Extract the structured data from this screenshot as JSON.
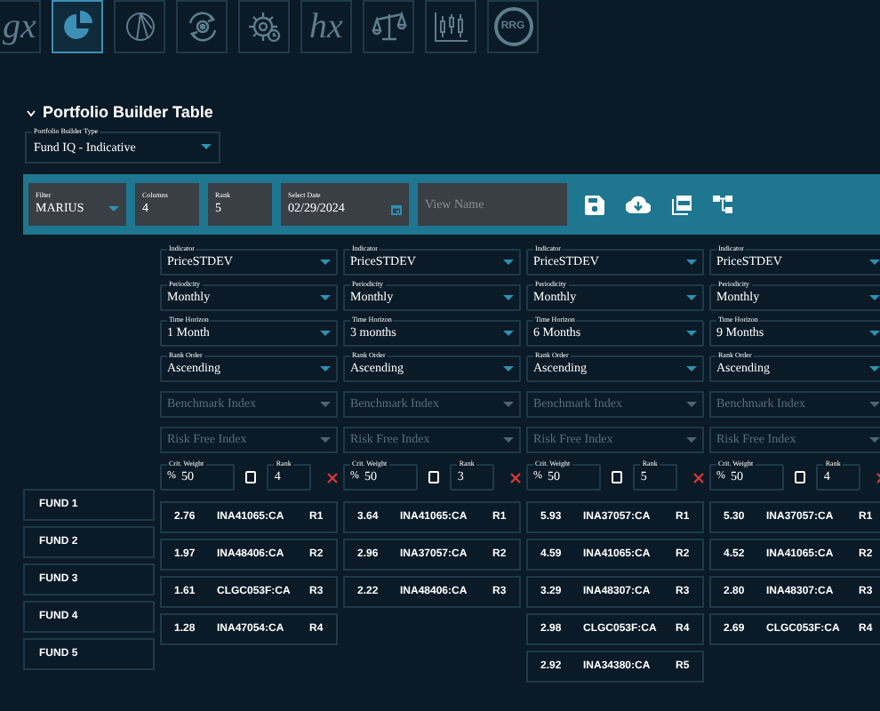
{
  "top_icons": [
    {
      "kind": "text",
      "label": "gx",
      "selected": false
    },
    {
      "kind": "pie",
      "selected": true
    },
    {
      "kind": "pie-outline",
      "selected": false
    },
    {
      "kind": "gear-cycle",
      "selected": false
    },
    {
      "kind": "gear-clock",
      "selected": false
    },
    {
      "kind": "text",
      "label": "hx",
      "selected": false
    },
    {
      "kind": "scale",
      "selected": false
    },
    {
      "kind": "candles",
      "selected": false
    },
    {
      "kind": "badge",
      "label": "RRG",
      "selected": false
    }
  ],
  "section": {
    "title": "Portfolio Builder Table",
    "expanded": true
  },
  "builder_type": {
    "label": "Portfolio Builder Type",
    "value": "Fund IQ - Indicative"
  },
  "toolbar": {
    "filter": {
      "label": "Filter",
      "value": "MARIUS"
    },
    "columns": {
      "label": "Columns",
      "value": "4"
    },
    "rank": {
      "label": "Rank",
      "value": "5"
    },
    "date": {
      "label": "Select Date",
      "value": "02/29/2024"
    },
    "view_name": {
      "placeholder": "View Name"
    }
  },
  "columns": [
    {
      "fields": [
        {
          "label": "Indicator",
          "value": "PriceSTDEV"
        },
        {
          "label": "Periodicity",
          "value": "Monthly"
        },
        {
          "label": "Time Horizon",
          "value": "1 Month"
        },
        {
          "label": "Rank Order",
          "value": "Ascending"
        }
      ],
      "benchmark": {
        "placeholder": "Benchmark Index"
      },
      "risk_free": {
        "placeholder": "Risk Free Index"
      },
      "weight": {
        "label": "Crit. Weight",
        "prefix": "%",
        "value": "50"
      },
      "checked": false,
      "rank": {
        "label": "Rank",
        "value": "4"
      },
      "results": [
        {
          "score": "2.76",
          "ticker": "INA41065:CA",
          "rank": "R1"
        },
        {
          "score": "1.97",
          "ticker": "INA48406:CA",
          "rank": "R2"
        },
        {
          "score": "1.61",
          "ticker": "CLGC053F:CA",
          "rank": "R3"
        },
        {
          "score": "1.28",
          "ticker": "INA47054:CA",
          "rank": "R4"
        }
      ]
    },
    {
      "fields": [
        {
          "label": "Indicator",
          "value": "PriceSTDEV"
        },
        {
          "label": "Periodicity",
          "value": "Monthly"
        },
        {
          "label": "Time Horizon",
          "value": "3 months"
        },
        {
          "label": "Rank Order",
          "value": "Ascending"
        }
      ],
      "benchmark": {
        "placeholder": "Benchmark Index"
      },
      "risk_free": {
        "placeholder": "Risk Free Index"
      },
      "weight": {
        "label": "Crit. Weight",
        "prefix": "%",
        "value": "50"
      },
      "checked": false,
      "rank": {
        "label": "Rank",
        "value": "3"
      },
      "results": [
        {
          "score": "3.64",
          "ticker": "INA41065:CA",
          "rank": "R1"
        },
        {
          "score": "2.96",
          "ticker": "INA37057:CA",
          "rank": "R2"
        },
        {
          "score": "2.22",
          "ticker": "INA48406:CA",
          "rank": "R3"
        }
      ]
    },
    {
      "fields": [
        {
          "label": "Indicator",
          "value": "PriceSTDEV"
        },
        {
          "label": "Periodicity",
          "value": "Monthly"
        },
        {
          "label": "Time Horizon",
          "value": "6 Months"
        },
        {
          "label": "Rank Order",
          "value": "Ascending"
        }
      ],
      "benchmark": {
        "placeholder": "Benchmark Index"
      },
      "risk_free": {
        "placeholder": "Risk Free Index"
      },
      "weight": {
        "label": "Crit. Weight",
        "prefix": "%",
        "value": "50"
      },
      "checked": false,
      "rank": {
        "label": "Rank",
        "value": "5"
      },
      "results": [
        {
          "score": "5.93",
          "ticker": "INA37057:CA",
          "rank": "R1"
        },
        {
          "score": "4.59",
          "ticker": "INA41065:CA",
          "rank": "R2"
        },
        {
          "score": "3.29",
          "ticker": "INA48307:CA",
          "rank": "R3"
        },
        {
          "score": "2.98",
          "ticker": "CLGC053F:CA",
          "rank": "R4"
        },
        {
          "score": "2.92",
          "ticker": "INA34380:CA",
          "rank": "R5"
        }
      ]
    },
    {
      "fields": [
        {
          "label": "Indicator",
          "value": "PriceSTDEV"
        },
        {
          "label": "Periodicity",
          "value": "Monthly"
        },
        {
          "label": "Time Horizon",
          "value": "9 Months"
        },
        {
          "label": "Rank Order",
          "value": "Ascending"
        }
      ],
      "benchmark": {
        "placeholder": "Benchmark Index"
      },
      "risk_free": {
        "placeholder": "Risk Free Index"
      },
      "weight": {
        "label": "Crit. Weight",
        "prefix": "%",
        "value": "50"
      },
      "checked": false,
      "rank": {
        "label": "Rank",
        "value": "4"
      },
      "results": [
        {
          "score": "5.30",
          "ticker": "INA37057:CA",
          "rank": "R1"
        },
        {
          "score": "4.52",
          "ticker": "INA41065:CA",
          "rank": "R2"
        },
        {
          "score": "2.80",
          "ticker": "INA48307:CA",
          "rank": "R3"
        },
        {
          "score": "2.69",
          "ticker": "CLGC053F:CA",
          "rank": "R4"
        }
      ]
    }
  ],
  "funds": [
    "FUND 1",
    "FUND 2",
    "FUND 3",
    "FUND 4",
    "FUND 5"
  ]
}
